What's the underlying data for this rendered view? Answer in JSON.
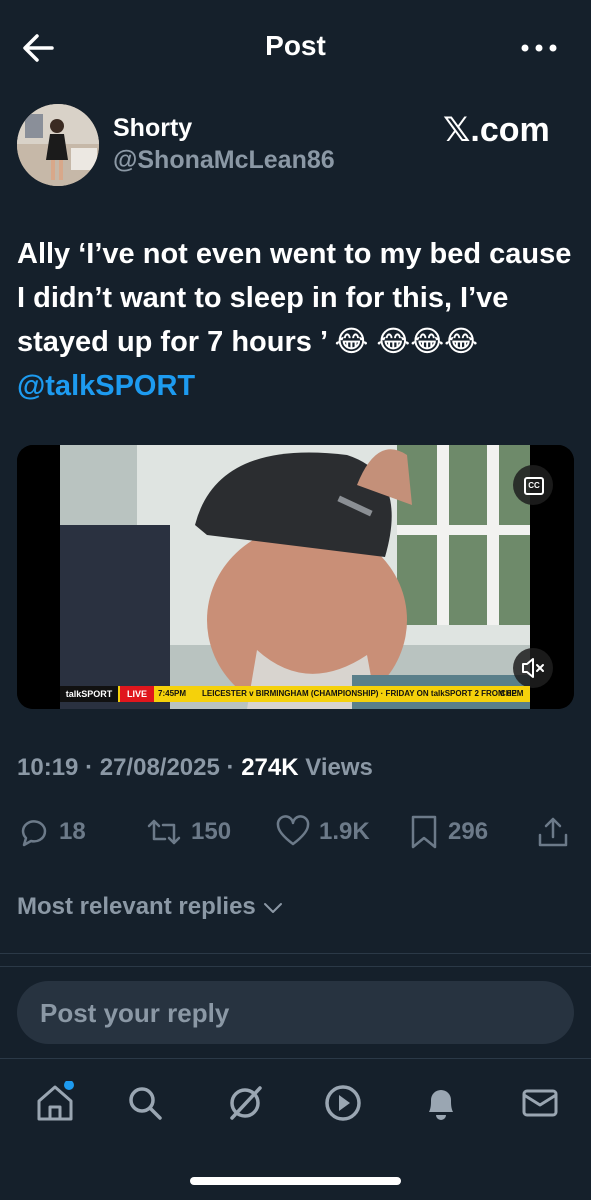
{
  "header": {
    "title": "Post"
  },
  "author": {
    "name": "Shorty",
    "handle": "@ShonaMcLean86"
  },
  "watermark": "𝕏.com",
  "tweet": {
    "text_part1": "Ally ‘I’ve not even went to my bed cause I didn’t want to sleep in for this, I’ve stayed up for 7 hours ’ 😂",
    "text_part2": "😂😂😂 ",
    "mention": "@talkSPORT"
  },
  "media": {
    "cc_label": "CC",
    "ticker": {
      "brand": "talkSPORT",
      "live": "LIVE",
      "time": "7:45PM",
      "text": "LEICESTER v BIRMINGHAM (CHAMPIONSHIP) · FRIDAY ON talkSPORT 2 FROM 8PM",
      "tail": "CHE"
    }
  },
  "meta": {
    "time": "10:19",
    "date": "27/08/2025",
    "views_count": "274K",
    "views_label": "Views",
    "sep": "·"
  },
  "actions": {
    "replies": "18",
    "reposts": "150",
    "likes": "1.9K",
    "bookmarks": "296"
  },
  "replies_section": {
    "label": "Most relevant replies"
  },
  "reply_input": {
    "placeholder": "Post your reply"
  },
  "nav": {
    "home_has_notification": true
  },
  "colors": {
    "background": "#15202b",
    "accent": "#1d9bf0",
    "muted": "#8b98a5",
    "ticker": "#f5d10b"
  }
}
